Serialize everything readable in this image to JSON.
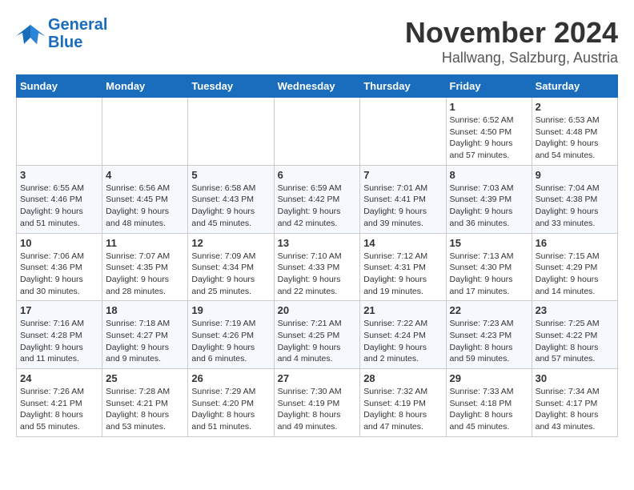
{
  "header": {
    "logo_line1": "General",
    "logo_line2": "Blue",
    "month": "November 2024",
    "location": "Hallwang, Salzburg, Austria"
  },
  "weekdays": [
    "Sunday",
    "Monday",
    "Tuesday",
    "Wednesday",
    "Thursday",
    "Friday",
    "Saturday"
  ],
  "weeks": [
    [
      {
        "day": "",
        "detail": ""
      },
      {
        "day": "",
        "detail": ""
      },
      {
        "day": "",
        "detail": ""
      },
      {
        "day": "",
        "detail": ""
      },
      {
        "day": "",
        "detail": ""
      },
      {
        "day": "1",
        "detail": "Sunrise: 6:52 AM\nSunset: 4:50 PM\nDaylight: 9 hours\nand 57 minutes."
      },
      {
        "day": "2",
        "detail": "Sunrise: 6:53 AM\nSunset: 4:48 PM\nDaylight: 9 hours\nand 54 minutes."
      }
    ],
    [
      {
        "day": "3",
        "detail": "Sunrise: 6:55 AM\nSunset: 4:46 PM\nDaylight: 9 hours\nand 51 minutes."
      },
      {
        "day": "4",
        "detail": "Sunrise: 6:56 AM\nSunset: 4:45 PM\nDaylight: 9 hours\nand 48 minutes."
      },
      {
        "day": "5",
        "detail": "Sunrise: 6:58 AM\nSunset: 4:43 PM\nDaylight: 9 hours\nand 45 minutes."
      },
      {
        "day": "6",
        "detail": "Sunrise: 6:59 AM\nSunset: 4:42 PM\nDaylight: 9 hours\nand 42 minutes."
      },
      {
        "day": "7",
        "detail": "Sunrise: 7:01 AM\nSunset: 4:41 PM\nDaylight: 9 hours\nand 39 minutes."
      },
      {
        "day": "8",
        "detail": "Sunrise: 7:03 AM\nSunset: 4:39 PM\nDaylight: 9 hours\nand 36 minutes."
      },
      {
        "day": "9",
        "detail": "Sunrise: 7:04 AM\nSunset: 4:38 PM\nDaylight: 9 hours\nand 33 minutes."
      }
    ],
    [
      {
        "day": "10",
        "detail": "Sunrise: 7:06 AM\nSunset: 4:36 PM\nDaylight: 9 hours\nand 30 minutes."
      },
      {
        "day": "11",
        "detail": "Sunrise: 7:07 AM\nSunset: 4:35 PM\nDaylight: 9 hours\nand 28 minutes."
      },
      {
        "day": "12",
        "detail": "Sunrise: 7:09 AM\nSunset: 4:34 PM\nDaylight: 9 hours\nand 25 minutes."
      },
      {
        "day": "13",
        "detail": "Sunrise: 7:10 AM\nSunset: 4:33 PM\nDaylight: 9 hours\nand 22 minutes."
      },
      {
        "day": "14",
        "detail": "Sunrise: 7:12 AM\nSunset: 4:31 PM\nDaylight: 9 hours\nand 19 minutes."
      },
      {
        "day": "15",
        "detail": "Sunrise: 7:13 AM\nSunset: 4:30 PM\nDaylight: 9 hours\nand 17 minutes."
      },
      {
        "day": "16",
        "detail": "Sunrise: 7:15 AM\nSunset: 4:29 PM\nDaylight: 9 hours\nand 14 minutes."
      }
    ],
    [
      {
        "day": "17",
        "detail": "Sunrise: 7:16 AM\nSunset: 4:28 PM\nDaylight: 9 hours\nand 11 minutes."
      },
      {
        "day": "18",
        "detail": "Sunrise: 7:18 AM\nSunset: 4:27 PM\nDaylight: 9 hours\nand 9 minutes."
      },
      {
        "day": "19",
        "detail": "Sunrise: 7:19 AM\nSunset: 4:26 PM\nDaylight: 9 hours\nand 6 minutes."
      },
      {
        "day": "20",
        "detail": "Sunrise: 7:21 AM\nSunset: 4:25 PM\nDaylight: 9 hours\nand 4 minutes."
      },
      {
        "day": "21",
        "detail": "Sunrise: 7:22 AM\nSunset: 4:24 PM\nDaylight: 9 hours\nand 2 minutes."
      },
      {
        "day": "22",
        "detail": "Sunrise: 7:23 AM\nSunset: 4:23 PM\nDaylight: 8 hours\nand 59 minutes."
      },
      {
        "day": "23",
        "detail": "Sunrise: 7:25 AM\nSunset: 4:22 PM\nDaylight: 8 hours\nand 57 minutes."
      }
    ],
    [
      {
        "day": "24",
        "detail": "Sunrise: 7:26 AM\nSunset: 4:21 PM\nDaylight: 8 hours\nand 55 minutes."
      },
      {
        "day": "25",
        "detail": "Sunrise: 7:28 AM\nSunset: 4:21 PM\nDaylight: 8 hours\nand 53 minutes."
      },
      {
        "day": "26",
        "detail": "Sunrise: 7:29 AM\nSunset: 4:20 PM\nDaylight: 8 hours\nand 51 minutes."
      },
      {
        "day": "27",
        "detail": "Sunrise: 7:30 AM\nSunset: 4:19 PM\nDaylight: 8 hours\nand 49 minutes."
      },
      {
        "day": "28",
        "detail": "Sunrise: 7:32 AM\nSunset: 4:19 PM\nDaylight: 8 hours\nand 47 minutes."
      },
      {
        "day": "29",
        "detail": "Sunrise: 7:33 AM\nSunset: 4:18 PM\nDaylight: 8 hours\nand 45 minutes."
      },
      {
        "day": "30",
        "detail": "Sunrise: 7:34 AM\nSunset: 4:17 PM\nDaylight: 8 hours\nand 43 minutes."
      }
    ]
  ]
}
